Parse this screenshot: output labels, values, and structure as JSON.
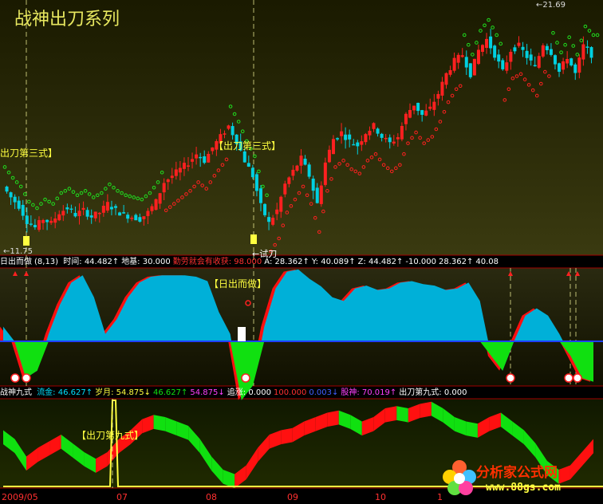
{
  "title": "战神出刀系列",
  "colors": {
    "up": "#ff2020",
    "down": "#00d0e0",
    "area_blue": "#00b0d8",
    "area_red": "#ff1010",
    "area_green": "#10e010",
    "white": "#ffffff",
    "yellow": "#ffff40"
  },
  "price_panel": {
    "high_label": "21.69",
    "low_label": "11.75",
    "test_label": "←试刀",
    "signal_label": "【出刀第三式】",
    "partial_label": "出刀第三式】"
  },
  "panel2": {
    "name": "日出而做",
    "params": "(8,13)",
    "signal_label": "【日出而做】",
    "items": [
      {
        "label": "时间:",
        "value": "44.482",
        "arrow": "↑",
        "color": "#ffffff"
      },
      {
        "label": "地基:",
        "value": "30.000",
        "arrow": "",
        "color": "#ffffff"
      },
      {
        "label": "勤劳就会有收获:",
        "value": "98.000",
        "arrow": "",
        "color": "#ff3030"
      },
      {
        "label": "A:",
        "value": "28.362",
        "arrow": "↑",
        "color": "#ffffff"
      },
      {
        "label": "Y:",
        "value": "40.089",
        "arrow": "↑",
        "color": "#ffffff"
      },
      {
        "label": "Z:",
        "value": "44.482",
        "arrow": "↑",
        "color": "#ffffff"
      },
      {
        "label": "",
        "value": "-10.000",
        "arrow": "",
        "color": "#ffffff"
      },
      {
        "label": "",
        "value": "28.362",
        "arrow": "↑",
        "color": "#ffffff"
      },
      {
        "label": "",
        "value": "40.08",
        "arrow": "",
        "color": "#ffffff"
      }
    ]
  },
  "panel3": {
    "name": "战神九式",
    "signal_label": "【出刀第九式】",
    "items": [
      {
        "label": "流金:",
        "value": "46.627",
        "arrow": "↑",
        "color": "#00e0ff"
      },
      {
        "label": "岁月:",
        "value": "54.875",
        "arrow": "↓",
        "color": "#ffff40"
      },
      {
        "label": "",
        "value": "46.627",
        "arrow": "↑",
        "color": "#10e010"
      },
      {
        "label": "",
        "value": "54.875",
        "arrow": "↓",
        "color": "#ff40ff"
      },
      {
        "label": "追涨:",
        "value": "0.000",
        "arrow": "",
        "color": "#ffffff"
      },
      {
        "label": "",
        "value": "100.000",
        "arrow": "",
        "color": "#ff3030"
      },
      {
        "label": "",
        "value": "0.003",
        "arrow": "↓",
        "color": "#4060ff"
      },
      {
        "label": "股神:",
        "value": "70.019",
        "arrow": "↑",
        "color": "#ff40ff"
      },
      {
        "label": "出刀第九式:",
        "value": "0.000",
        "arrow": "",
        "color": "#ffffff"
      }
    ]
  },
  "x_axis": {
    "ticks": [
      "2009/05",
      "07",
      "08",
      "09",
      "10",
      "1"
    ]
  },
  "watermark": {
    "line1": "分析家公式网",
    "line2": "www.88gs.com"
  },
  "chart_data": {
    "type": "candlestick",
    "price": {
      "low": 11.75,
      "high": 21.69,
      "ylim": [
        11.0,
        22.5
      ]
    },
    "close_path": [
      14.1,
      13.6,
      13.2,
      12.5,
      12.2,
      12.6,
      12.4,
      12.9,
      13.1,
      12.8,
      13.0,
      12.7,
      12.9,
      13.3,
      13.0,
      12.8,
      12.7,
      12.6,
      12.9,
      13.4,
      14.3,
      14.6,
      14.9,
      15.2,
      15.6,
      15.3,
      15.9,
      16.4,
      16.9,
      16.2,
      15.3,
      14.6,
      13.2,
      12.4,
      13.0,
      14.2,
      14.8,
      15.4,
      14.6,
      13.3,
      15.2,
      16.3,
      16.6,
      16.2,
      16.0,
      16.6,
      16.9,
      16.4,
      16.1,
      16.4,
      17.4,
      17.9,
      17.4,
      17.7,
      18.4,
      19.3,
      19.9,
      20.2,
      19.3,
      20.4,
      20.9,
      20.2,
      19.4,
      20.4,
      20.6,
      20.1,
      19.6,
      20.7,
      20.3,
      19.4,
      20.1,
      19.3,
      20.6,
      20.2
    ],
    "osc_blue": [
      0.2,
      0.0,
      -0.5,
      -0.4,
      0.1,
      0.5,
      0.8,
      0.9,
      0.6,
      0.1,
      0.3,
      0.6,
      0.8,
      0.88,
      0.9,
      0.9,
      0.9,
      0.88,
      0.82,
      0.4,
      0.1,
      -0.8,
      -0.6,
      0.2,
      0.72,
      0.95,
      0.98,
      0.85,
      0.75,
      0.6,
      0.55,
      0.72,
      0.76,
      0.7,
      0.72,
      0.8,
      0.82,
      0.78,
      0.76,
      0.7,
      0.72,
      0.8,
      0.55,
      -0.2,
      -0.4,
      0.0,
      0.35,
      0.45,
      0.35,
      0.1,
      -0.2,
      -0.5,
      -0.55
    ],
    "osc_nine": [
      0.3,
      0.1,
      -0.3,
      -0.1,
      0.05,
      0.2,
      0.0,
      -0.2,
      -0.35,
      -0.2,
      0.1,
      0.3,
      0.55,
      0.65,
      0.6,
      0.5,
      0.4,
      0.1,
      -0.3,
      -0.6,
      -0.7,
      -0.5,
      -0.1,
      0.2,
      0.3,
      0.35,
      0.5,
      0.6,
      0.7,
      0.75,
      0.65,
      0.5,
      0.6,
      0.8,
      0.85,
      0.8,
      0.9,
      0.95,
      0.8,
      0.6,
      0.5,
      0.45,
      0.6,
      0.7,
      0.5,
      0.3,
      0.0,
      -0.4,
      -0.6,
      -0.5,
      -0.2,
      0.1
    ]
  }
}
